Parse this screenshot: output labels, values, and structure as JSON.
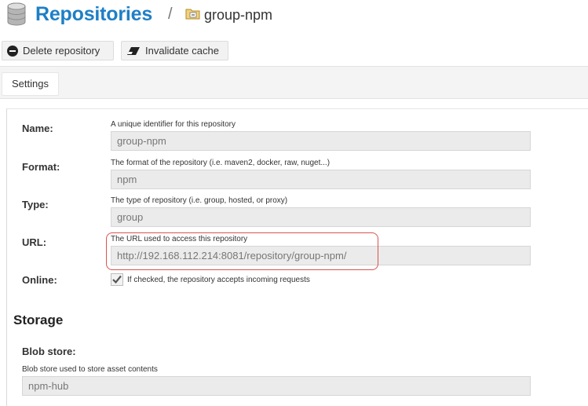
{
  "header": {
    "title": "Repositories",
    "separator": "/",
    "repo_name": "group-npm"
  },
  "toolbar": {
    "delete_label": "Delete repository",
    "invalidate_label": "Invalidate cache"
  },
  "tabs": [
    {
      "label": "Settings",
      "active": true
    }
  ],
  "form": {
    "name": {
      "label": "Name:",
      "help": "A unique identifier for this repository",
      "value": "group-npm"
    },
    "format": {
      "label": "Format:",
      "help": "The format of the repository (i.e. maven2, docker, raw, nuget...)",
      "value": "npm"
    },
    "type": {
      "label": "Type:",
      "help": "The type of repository (i.e. group, hosted, or proxy)",
      "value": "group"
    },
    "url": {
      "label": "URL:",
      "help": "The URL used to access this repository",
      "value": "http://192.168.112.214:8081/repository/group-npm/"
    },
    "online": {
      "label": "Online:",
      "help": "If checked, the repository accepts incoming requests",
      "checked": true
    }
  },
  "storage": {
    "title": "Storage",
    "blob_store": {
      "label": "Blob store:",
      "help": "Blob store used to store asset contents",
      "value": "npm-hub"
    }
  },
  "colors": {
    "title_blue": "#1e7fc6",
    "highlight_red": "#d9534f",
    "field_bg": "#ebebeb"
  }
}
